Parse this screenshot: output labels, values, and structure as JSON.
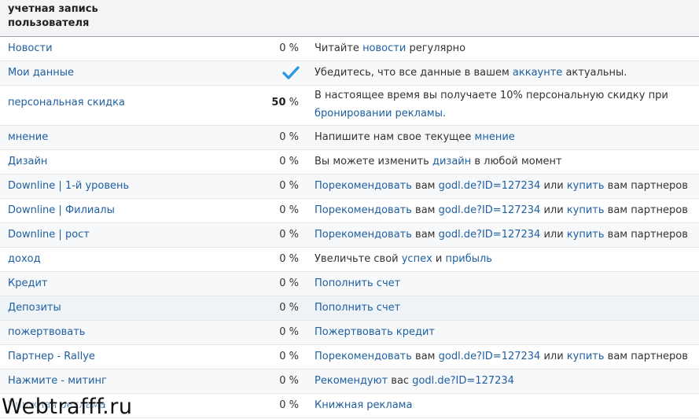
{
  "header": {
    "title": "учетная запись пользователя"
  },
  "rows": [
    {
      "name": "Новости",
      "pct_num": "0",
      "pct_sym": " %",
      "desc": [
        {
          "t": "Читайте "
        },
        {
          "l": "новости"
        },
        {
          "t": " регулярно"
        }
      ]
    },
    {
      "name": "Мои данные",
      "pct_num": "",
      "pct_sym": "",
      "done": true,
      "desc": [
        {
          "t": "Убедитесь, что все данные в вашем "
        },
        {
          "l": "аккаунте"
        },
        {
          "t": " актуальны."
        }
      ]
    },
    {
      "name": "персональная скидка",
      "pct_num": "50",
      "pct_sym": " %",
      "bold": true,
      "desc": [
        {
          "t": "В настоящее время вы получаете 10% персональную скидку при "
        },
        {
          "l": "бронировании рекламы."
        }
      ]
    },
    {
      "name": "мнение",
      "pct_num": "0",
      "pct_sym": " %",
      "desc": [
        {
          "t": "Напишите нам свое текущее "
        },
        {
          "l": "мнение"
        }
      ]
    },
    {
      "name": "Дизайн",
      "pct_num": "0",
      "pct_sym": " %",
      "desc": [
        {
          "t": "Вы можете изменить "
        },
        {
          "l": "дизайн"
        },
        {
          "t": " в любой момент"
        }
      ]
    },
    {
      "name": "Downline | 1-й уровень",
      "pct_num": "0",
      "pct_sym": " %",
      "desc": [
        {
          "l": "Порекомендовать"
        },
        {
          "t": " вам "
        },
        {
          "l": "godl.de?ID=127234"
        },
        {
          "t": " или "
        },
        {
          "l": "купить"
        },
        {
          "t": " вам партнеров"
        }
      ]
    },
    {
      "name": "Downline | Филиалы",
      "pct_num": "0",
      "pct_sym": " %",
      "desc": [
        {
          "l": "Порекомендовать"
        },
        {
          "t": " вам "
        },
        {
          "l": "godl.de?ID=127234"
        },
        {
          "t": " или "
        },
        {
          "l": "купить"
        },
        {
          "t": " вам партнеров"
        }
      ]
    },
    {
      "name": "Downline | рост",
      "pct_num": "0",
      "pct_sym": " %",
      "desc": [
        {
          "l": "Порекомендовать"
        },
        {
          "t": " вам "
        },
        {
          "l": "godl.de?ID=127234"
        },
        {
          "t": " или "
        },
        {
          "l": "купить"
        },
        {
          "t": " вам партнеров"
        }
      ]
    },
    {
      "name": "доход",
      "pct_num": "0",
      "pct_sym": " %",
      "desc": [
        {
          "t": "Увеличьте свой "
        },
        {
          "l": "успех"
        },
        {
          "t": " и "
        },
        {
          "l": "прибыль"
        }
      ]
    },
    {
      "name": "Кредит",
      "pct_num": "0",
      "pct_sym": " %",
      "desc": [
        {
          "l": "Пополнить счет"
        }
      ]
    },
    {
      "name": "Депозиты",
      "pct_num": "0",
      "pct_sym": " %",
      "highlight": true,
      "desc": [
        {
          "l": "Пополнить счет"
        }
      ]
    },
    {
      "name": "пожертвовать",
      "pct_num": "0",
      "pct_sym": " %",
      "desc": [
        {
          "l": "Пожертвовать кредит"
        }
      ]
    },
    {
      "name": "Партнер - Rallye",
      "pct_num": "0",
      "pct_sym": " %",
      "desc": [
        {
          "l": "Порекомендовать"
        },
        {
          "t": " вам "
        },
        {
          "l": "godl.de?ID=127234"
        },
        {
          "t": " или "
        },
        {
          "l": "купить"
        },
        {
          "t": " вам партнеров"
        }
      ]
    },
    {
      "name": "Нажмите - митинг",
      "pct_num": "0",
      "pct_sym": " %",
      "desc": [
        {
          "l": "Рекомендуют"
        },
        {
          "t": " вас "
        },
        {
          "l": "godl.de?ID=127234"
        }
      ]
    },
    {
      "name": "Книжная реклама",
      "pct_num": "0",
      "pct_sym": " %",
      "desc": [
        {
          "l": "Книжная реклама"
        }
      ]
    }
  ],
  "watermark": "Webtrafff.ru",
  "colors": {
    "link": "#1f5fa0",
    "check": "#2b9be0",
    "header_bg": "#f3f4f6"
  },
  "icons": {
    "done": "checkmark-icon"
  }
}
